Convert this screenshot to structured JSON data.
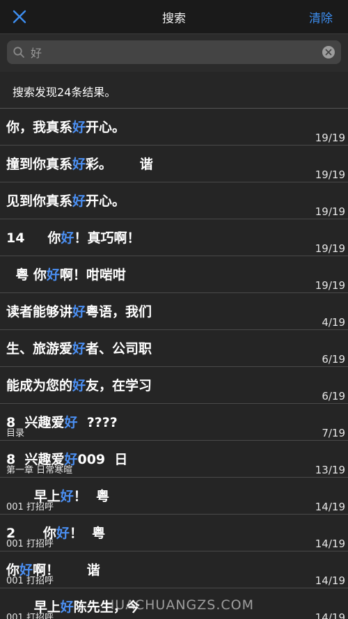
{
  "nav": {
    "title": "搜索",
    "clear_label": "清除",
    "close_icon": "close-icon"
  },
  "search": {
    "value": "好",
    "placeholder": ""
  },
  "summary": "搜索发现24条结果。",
  "colors": {
    "accent": "#4b8ff2",
    "background": "#222222"
  },
  "results": [
    {
      "before": "你，我真系",
      "hit": "好",
      "after": "开心。",
      "sub": "",
      "page": "19/19"
    },
    {
      "before": "撞到你真系",
      "hit": "好",
      "after": "彩。      谐",
      "sub": "",
      "page": "19/19"
    },
    {
      "before": "见到你真系",
      "hit": "好",
      "after": "开心。",
      "sub": "",
      "page": "19/19"
    },
    {
      "before": "14     你",
      "hit": "好",
      "after": "！真巧啊！",
      "sub": "",
      "page": "19/19"
    },
    {
      "before": "  粤 你",
      "hit": "好",
      "after": "啊！咁啱咁",
      "sub": "",
      "page": "19/19"
    },
    {
      "before": "读者能够讲",
      "hit": "好",
      "after": "粤语，我们",
      "sub": "",
      "page": "4/19"
    },
    {
      "before": "生、旅游爱",
      "hit": "好",
      "after": "者、公司职",
      "sub": "",
      "page": "6/19"
    },
    {
      "before": "能成为您的",
      "hit": "好",
      "after": "友，在学习",
      "sub": "",
      "page": "6/19"
    },
    {
      "before": "8  兴趣爱",
      "hit": "好",
      "after": "  ????",
      "sub": "目录",
      "page": "7/19"
    },
    {
      "before": "8  兴趣爱",
      "hit": "好",
      "after": "009  日",
      "sub": "第一章 日常寒暄",
      "page": "13/19"
    },
    {
      "before": "      早上",
      "hit": "好",
      "after": "！  粤",
      "sub": "001 打招呼",
      "page": "14/19"
    },
    {
      "before": "2      你",
      "hit": "好",
      "after": "！  粤",
      "sub": "001 打招呼",
      "page": "14/19"
    },
    {
      "before": "你",
      "hit": "好",
      "after": "啊！      谐",
      "sub": "001 打招呼",
      "page": "14/19"
    },
    {
      "before": "      早上",
      "hit": "好",
      "after": "陈先生，今",
      "sub": "001 打招呼",
      "page": "14/19"
    }
  ],
  "watermark": "HUACHUANGZS.COM"
}
